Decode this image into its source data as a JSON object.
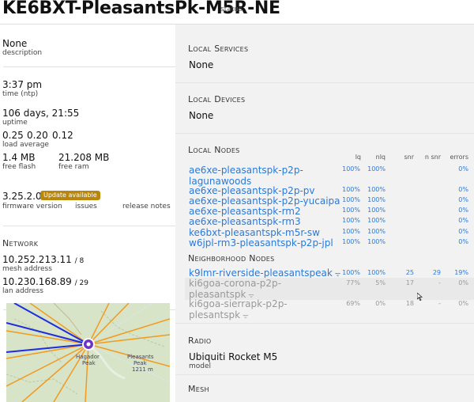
{
  "header": {
    "title": "KE6BXT-PleasantsPk-M5R-NE",
    "status_label": "status"
  },
  "info": {
    "description_value": "None",
    "description_label": "description",
    "time_value": "3:37 pm",
    "time_label": "time (ntp)",
    "uptime_value": "106 days, 21:55",
    "uptime_label": "uptime",
    "load_values": [
      "0.25",
      "0.20",
      "0.12"
    ],
    "load_label": "load average",
    "flash_value": "1.4 MB",
    "flash_label": "free flash",
    "ram_value": "21.208 MB",
    "ram_label": "free ram",
    "firmware_value": "3.25.2.0",
    "update_badge": "Update available",
    "firmware_label": "firmware version",
    "issues_label": "issues",
    "release_notes_label": "release notes"
  },
  "network": {
    "section_title": "Network",
    "mesh_ip": "10.252.213.11",
    "mesh_mask": "/ 8",
    "mesh_label": "mesh address",
    "lan_ip": "10.230.168.89",
    "lan_mask": "/ 29",
    "lan_label": "lan address"
  },
  "map": {
    "place1_name": "Hagador",
    "place1_sub": "Peak",
    "place2_name": "Pleasants",
    "place2_sub": "Peak",
    "place2_elev": "1211 m"
  },
  "local_services": {
    "title": "Local Services",
    "value": "None"
  },
  "local_devices": {
    "title": "Local Devices",
    "value": "None"
  },
  "local_nodes": {
    "title": "Local Nodes",
    "columns": [
      "lq",
      "nlq",
      "snr",
      "n snr",
      "errors"
    ],
    "rows": [
      {
        "name_line1": "ae6xe-pleasantspk-p2p-",
        "name_line2": "lagunawoods",
        "lq": "100%",
        "nlq": "100%",
        "errors": "0%"
      },
      {
        "name": "ae6xe-pleasantspk-p2p-pv",
        "lq": "100%",
        "nlq": "100%",
        "errors": "0%"
      },
      {
        "name": "ae6xe-pleasantspk-p2p-yucaipa",
        "lq": "100%",
        "nlq": "100%",
        "errors": "0%"
      },
      {
        "name": "ae6xe-pleasantspk-rm2",
        "lq": "100%",
        "nlq": "100%",
        "errors": "0%"
      },
      {
        "name": "ae6xe-pleasantspk-rm3",
        "lq": "100%",
        "nlq": "100%",
        "errors": "0%"
      },
      {
        "name": "ke6bxt-pleasantspk-m5r-sw",
        "lq": "100%",
        "nlq": "100%",
        "errors": "0%"
      },
      {
        "name": "w6jpl-rm3-pleasantspk-p2p-jpl",
        "lq": "100%",
        "nlq": "100%",
        "errors": "0%"
      }
    ]
  },
  "neighborhood": {
    "title": "Neighborhood Nodes",
    "rows": [
      {
        "name": "k9lmr-riverside-pleasantspeak",
        "lq": "100%",
        "nlq": "100%",
        "snr": "25",
        "nsnr": "29",
        "errors": "19%"
      },
      {
        "name_line1": "ki6goa-corona-p2p-",
        "name_line2": "pleasantspk",
        "lq": "77%",
        "nlq": "5%",
        "snr": "17",
        "nsnr": "-",
        "errors": "0%"
      },
      {
        "name_line1": "ki6goa-sierrapk-p2p-",
        "name_line2": "plesantspk",
        "lq": "69%",
        "nlq": "0%",
        "snr": "18",
        "nsnr": "-",
        "errors": "0%"
      }
    ]
  },
  "radio": {
    "title": "Radio",
    "model_value": "Ubiquiti Rocket M5",
    "model_label": "model"
  },
  "mesh": {
    "title": "Mesh"
  },
  "colors": {
    "link": "#2a7ad9",
    "badge": "#b8860b",
    "map_bg": "#d7e4c8",
    "map_marker": "#6b35c9"
  },
  "icons": {
    "wifi": "wifi-icon",
    "cursor": "mouse-cursor-icon"
  }
}
